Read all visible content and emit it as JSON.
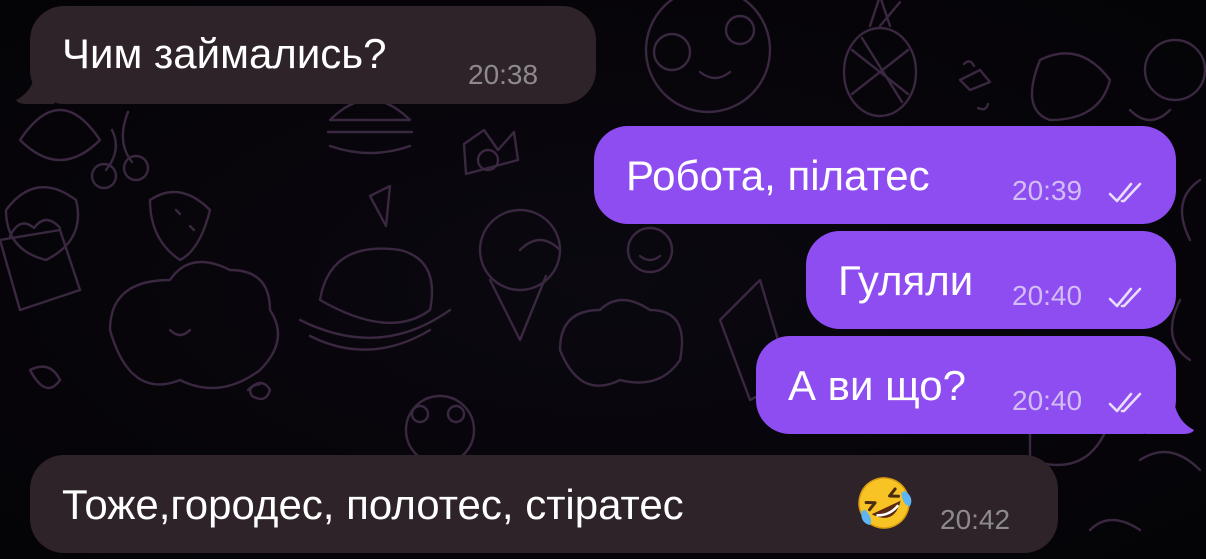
{
  "messages": [
    {
      "direction": "incoming",
      "text": "Чим займались?",
      "time": "20:38"
    },
    {
      "direction": "outgoing",
      "text": "Робота, пілатес",
      "time": "20:39",
      "status": "read"
    },
    {
      "direction": "outgoing",
      "text": "Гуляли",
      "time": "20:40",
      "status": "read"
    },
    {
      "direction": "outgoing",
      "text": "А ви що?",
      "time": "20:40",
      "status": "read"
    },
    {
      "direction": "incoming",
      "text": "Тоже,городес, полотес, стіратес",
      "emoji": "rolling-on-the-floor-laughing",
      "time": "20:42"
    }
  ],
  "colors": {
    "background": "#060508",
    "incoming_bubble": "#2e2329",
    "outgoing_bubble": "#8e4df0",
    "doodle_lines": "#3a2740"
  },
  "icons": {
    "read_receipt": "double-check-icon",
    "emoji": "rolling-laughing-emoji"
  }
}
